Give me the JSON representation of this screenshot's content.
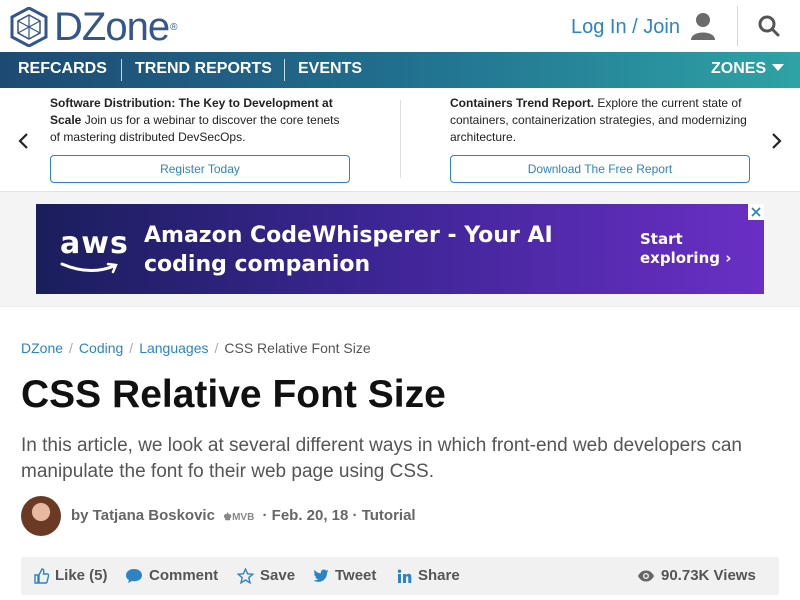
{
  "header": {
    "logo_text": "DZone",
    "logo_mark": "®",
    "login_label": "Log In / Join"
  },
  "nav": {
    "items": [
      "REFCARDS",
      "TREND REPORTS",
      "EVENTS"
    ],
    "zones_label": "ZONES"
  },
  "promos": [
    {
      "title": "Software Distribution: The Key to Development at Scale",
      "body": " Join us for a webinar to discover the core tenets of mastering distributed DevSecOps.",
      "button": "Register Today"
    },
    {
      "title": "Containers Trend Report.",
      "body": " Explore the current state of containers, containerization strategies, and modernizing architecture.",
      "button": "Download The Free Report"
    }
  ],
  "ad": {
    "brand": "aws",
    "headline": "Amazon CodeWhisperer - Your AI coding companion",
    "cta_line1": "Start",
    "cta_line2": "exploring ›"
  },
  "breadcrumb": [
    "DZone",
    "Coding",
    "Languages",
    "CSS Relative Font Size"
  ],
  "article": {
    "title": "CSS Relative Font Size",
    "subtitle": "In this article, we look at several different ways in which front-end web developers can manipulate the font fo their web page using CSS.",
    "author": "by Tatjana Boskovic",
    "badge": "MVB",
    "date": "Feb. 20, 18",
    "type": "Tutorial"
  },
  "actions": {
    "like": "Like (5)",
    "comment": "Comment",
    "save": "Save",
    "tweet": "Tweet",
    "share": "Share",
    "views": "90.73K Views"
  },
  "colors": {
    "brand_blue": "#34568b",
    "link_blue": "#2d84c5",
    "nav_start": "#1d4a73",
    "nav_end": "#2ea3a5"
  }
}
